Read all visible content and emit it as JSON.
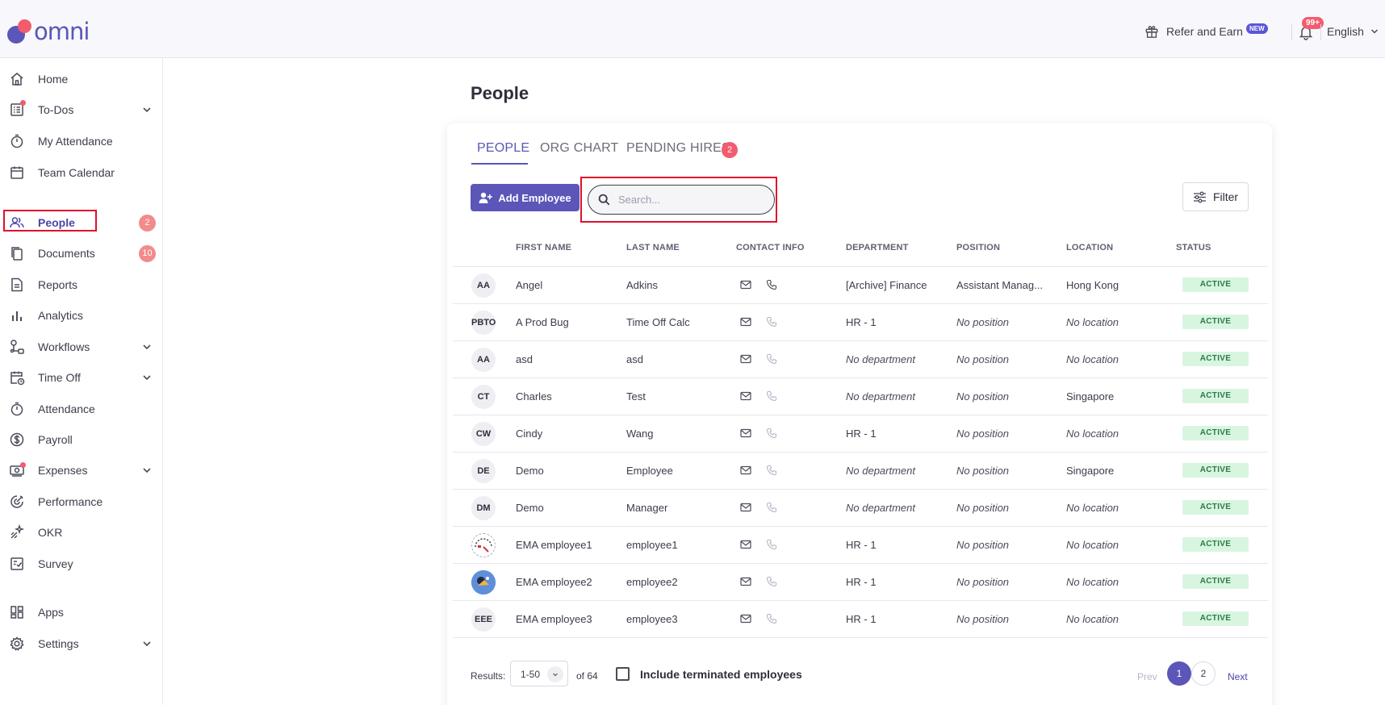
{
  "brand": {
    "name": "omni"
  },
  "topbar": {
    "refer_label": "Refer and Earn",
    "new_badge": "NEW",
    "notifications_count": "99+",
    "language": "English"
  },
  "sidebar": {
    "items": [
      {
        "label": "Home"
      },
      {
        "label": "To-Dos"
      },
      {
        "label": "My Attendance"
      },
      {
        "label": "Team Calendar"
      },
      {
        "label": "People",
        "badge": "2"
      },
      {
        "label": "Documents",
        "badge": "10"
      },
      {
        "label": "Reports"
      },
      {
        "label": "Analytics"
      },
      {
        "label": "Workflows"
      },
      {
        "label": "Time Off"
      },
      {
        "label": "Attendance"
      },
      {
        "label": "Payroll"
      },
      {
        "label": "Expenses"
      },
      {
        "label": "Performance"
      },
      {
        "label": "OKR"
      },
      {
        "label": "Survey"
      },
      {
        "label": "Apps"
      },
      {
        "label": "Settings"
      }
    ]
  },
  "main": {
    "title": "People",
    "tabs": [
      {
        "label": "PEOPLE"
      },
      {
        "label": "ORG CHART"
      },
      {
        "label": "PENDING HIRES",
        "badge": "2"
      }
    ],
    "add_button": "Add Employee",
    "search_placeholder": "Search...",
    "filter_label": "Filter",
    "columns": [
      "FIRST NAME",
      "LAST NAME",
      "CONTACT INFO",
      "DEPARTMENT",
      "POSITION",
      "LOCATION",
      "STATUS"
    ],
    "rows": [
      {
        "initials": "AA",
        "first": "Angel",
        "last": "Adkins",
        "department": "[Archive] Finance",
        "position": "Assistant Manag...",
        "location": "Hong Kong",
        "status": "ACTIVE"
      },
      {
        "initials": "PBTO",
        "first": "A Prod Bug",
        "last": "Time Off Calc",
        "department": "HR - 1",
        "position": "No position",
        "location": "No location",
        "status": "ACTIVE"
      },
      {
        "initials": "AA",
        "first": "asd",
        "last": "asd",
        "department": "No department",
        "position": "No position",
        "location": "No location",
        "status": "ACTIVE"
      },
      {
        "initials": "CT",
        "first": "Charles",
        "last": "Test",
        "department": "No department",
        "position": "No position",
        "location": "Singapore",
        "status": "ACTIVE"
      },
      {
        "initials": "CW",
        "first": "Cindy",
        "last": "Wang",
        "department": "HR - 1",
        "position": "No position",
        "location": "No location",
        "status": "ACTIVE"
      },
      {
        "initials": "DE",
        "first": "Demo",
        "last": "Employee",
        "department": "No department",
        "position": "No position",
        "location": "Singapore",
        "status": "ACTIVE"
      },
      {
        "initials": "DM",
        "first": "Demo",
        "last": "Manager",
        "department": "No department",
        "position": "No position",
        "location": "No location",
        "status": "ACTIVE"
      },
      {
        "initials": "",
        "first": "EMA employee1",
        "last": "employee1",
        "department": "HR - 1",
        "position": "No position",
        "location": "No location",
        "status": "ACTIVE"
      },
      {
        "initials": "",
        "first": "EMA employee2",
        "last": "employee2",
        "department": "HR - 1",
        "position": "No position",
        "location": "No location",
        "status": "ACTIVE"
      },
      {
        "initials": "EEE",
        "first": "EMA employee3",
        "last": "employee3",
        "department": "HR - 1",
        "position": "No position",
        "location": "No location",
        "status": "ACTIVE"
      }
    ],
    "footer": {
      "results_label": "Results:",
      "per_page": "1-50",
      "of_total": "of 64",
      "include_terminated": "Include terminated employees",
      "prev": "Prev",
      "pages": [
        "1",
        "2"
      ],
      "next": "Next"
    }
  },
  "colors": {
    "accent": "#5b56b8",
    "badge": "#f25c6e",
    "status_bg": "#d8f5e0",
    "highlight": "#e0102a"
  }
}
